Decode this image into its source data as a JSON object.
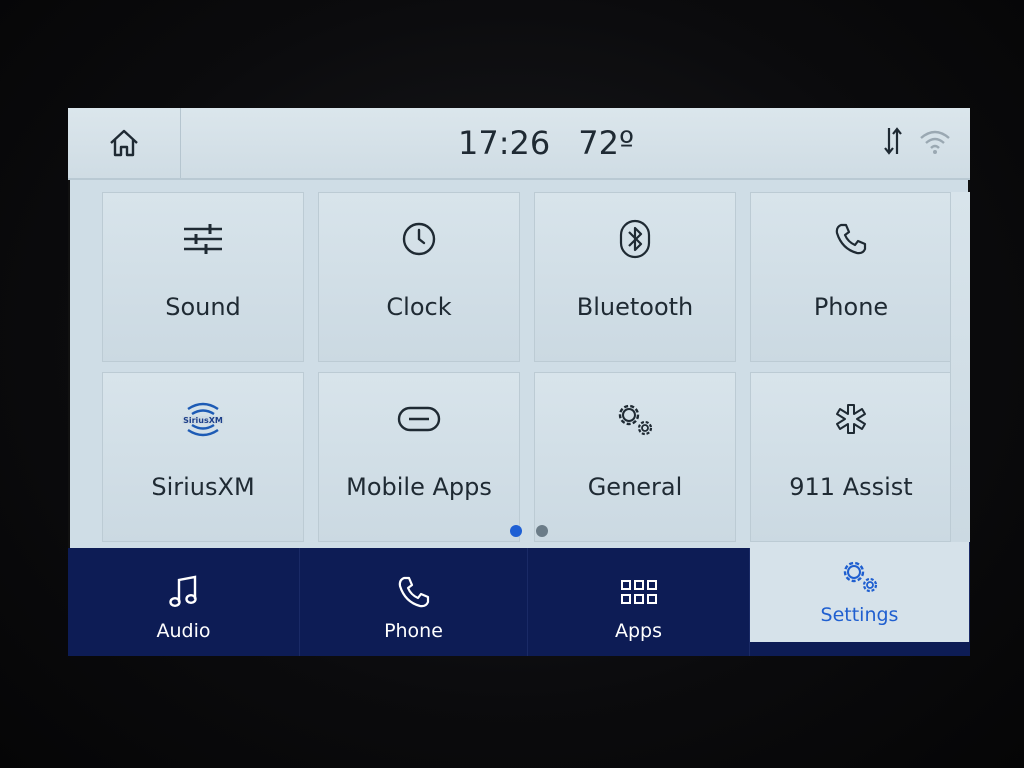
{
  "status_bar": {
    "time": "17:26",
    "temperature": "72º",
    "icons": [
      "home-icon",
      "data-transfer-icon",
      "wifi-icon"
    ]
  },
  "tiles": [
    {
      "label": "Sound",
      "icon": "sliders-icon"
    },
    {
      "label": "Clock",
      "icon": "clock-icon"
    },
    {
      "label": "Bluetooth",
      "icon": "bluetooth-icon"
    },
    {
      "label": "Phone",
      "icon": "phone-icon"
    },
    {
      "label": "SiriusXM",
      "icon": "siriusxm-icon",
      "logo_text": "SiriusXM"
    },
    {
      "label": "Mobile Apps",
      "icon": "link-icon"
    },
    {
      "label": "General",
      "icon": "gears-icon"
    },
    {
      "label": "911 Assist",
      "icon": "asterisk-icon"
    }
  ],
  "pagination": {
    "pages": 2,
    "current": 1,
    "active_color": "#1e5fd4"
  },
  "nav": {
    "items": [
      {
        "label": "Audio",
        "icon": "music-note-icon"
      },
      {
        "label": "Phone",
        "icon": "phone-icon"
      },
      {
        "label": "Apps",
        "icon": "apps-grid-icon"
      },
      {
        "label": "Settings",
        "icon": "gears-icon",
        "active": true
      }
    ],
    "background": "#0d1c55",
    "active_color": "#1f5fd0"
  }
}
